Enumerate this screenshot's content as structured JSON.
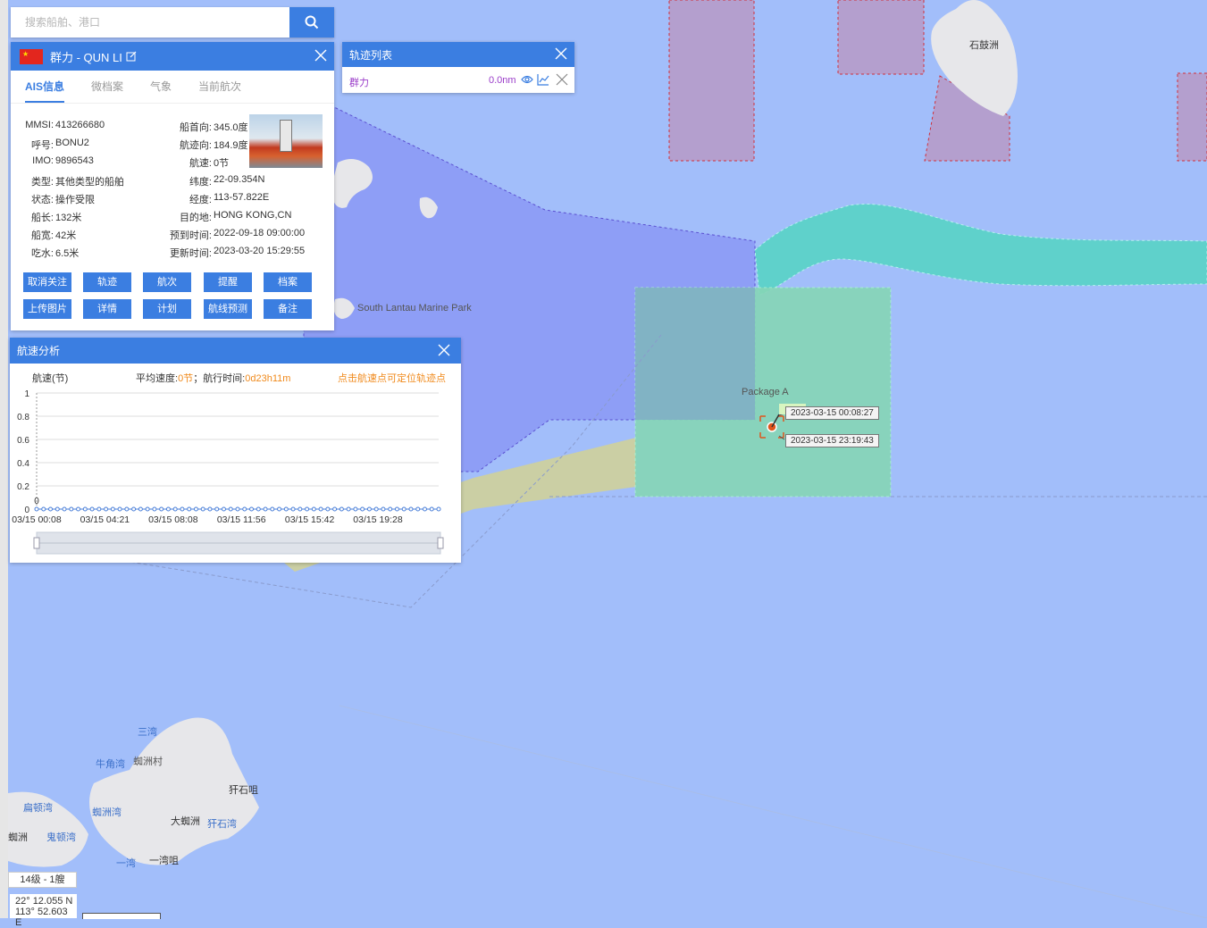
{
  "search": {
    "placeholder": "搜索船舶、港口",
    "icon": "search-icon"
  },
  "ship": {
    "flag_color": "#e3261e",
    "name": "群力 - QUN LI",
    "tabs": [
      "AIS信息",
      "微档案",
      "气象",
      "当前航次"
    ],
    "info_left": [
      {
        "label": "MMSI:",
        "value": "413266680"
      },
      {
        "label": "呼号:",
        "value": "BONU2"
      },
      {
        "label": "IMO:",
        "value": "9896543"
      },
      {
        "label": "类型:",
        "value": "其他类型的船舶"
      },
      {
        "label": "状态:",
        "value": "操作受限"
      },
      {
        "label": "船长:",
        "value": "132米"
      },
      {
        "label": "船宽:",
        "value": "42米"
      },
      {
        "label": "吃水:",
        "value": "6.5米"
      }
    ],
    "info_right": [
      {
        "label": "船首向:",
        "value": "345.0度"
      },
      {
        "label": "航迹向:",
        "value": "184.9度"
      },
      {
        "label": "航速:",
        "value": "0节"
      },
      {
        "label": "纬度:",
        "value": "22-09.354N"
      },
      {
        "label": "经度:",
        "value": "113-57.822E"
      },
      {
        "label": "目的地:",
        "value": "HONG KONG,CN"
      },
      {
        "label": "预到时间:",
        "value": "2022-09-18 09:00:00"
      },
      {
        "label": "更新时间:",
        "value": "2023-03-20 15:29:55"
      }
    ],
    "buttons": [
      "取消关注",
      "轨迹",
      "航次",
      "提醒",
      "档案",
      "上传图片",
      "详情",
      "计划",
      "航线预测",
      "备注"
    ]
  },
  "track_list": {
    "title": "轨迹列表",
    "items": [
      {
        "name": "群力",
        "distance": "0.0nm"
      }
    ]
  },
  "speed_panel": {
    "title": "航速分析",
    "y_label": "航速(节)",
    "avg_label": "平均速度:",
    "avg_value": "0节",
    "sep": "；",
    "time_label": "航行时间:",
    "time_value": "0d23h11m",
    "hint": "点击航速点可定位轨迹点"
  },
  "chart_data": {
    "type": "line",
    "x_ticks": [
      "03/15 00:08",
      "03/15 04:21",
      "03/15 08:08",
      "03/15 11:56",
      "03/15 15:42",
      "03/15 19:28"
    ],
    "y_ticks": [
      "0",
      "0.2",
      "0.4",
      "0.6",
      "0.8",
      "1"
    ],
    "ylim": [
      0,
      1
    ],
    "series": [
      {
        "values": [
          0,
          0,
          0,
          0,
          0,
          0,
          0,
          0,
          0,
          0,
          0,
          0,
          0,
          0,
          0,
          0,
          0,
          0,
          0,
          0,
          0,
          0,
          0,
          0,
          0,
          0,
          0,
          0,
          0,
          0,
          0,
          0,
          0,
          0,
          0,
          0,
          0,
          0,
          0,
          0,
          0,
          0,
          0,
          0,
          0,
          0,
          0,
          0,
          0,
          0,
          0,
          0,
          0,
          0,
          0,
          0,
          0,
          0,
          0
        ]
      }
    ],
    "first_point_label": "0",
    "line_color": "#4a7fd8"
  },
  "map": {
    "labels": {
      "shigu": "石鼓洲",
      "marine_park": "South Lantau Marine Park",
      "package_a": "Package A",
      "track_start": "2023-03-15 00:08:27",
      "track_end": "2023-03-15 23:19:43",
      "sanwan": "三湾",
      "niujiaowan": "牛角湾",
      "zhouzhoucun": "蜘洲村",
      "yashizui": "犴石咀",
      "biandunwan": "扁顿湾",
      "zhouzhouwan": "蜘洲湾",
      "dazhouzhou": "大蜘洲",
      "yashiwan": "犴石湾",
      "zhou": "蜘洲",
      "guidunwan": "鬼顿湾",
      "yiwan": "一湾",
      "yiwanzui": "一湾咀"
    },
    "zoom": "14级 - 1艘",
    "coord_lat": "22° 12.055 N",
    "coord_lon": "113° 52.603 E"
  }
}
